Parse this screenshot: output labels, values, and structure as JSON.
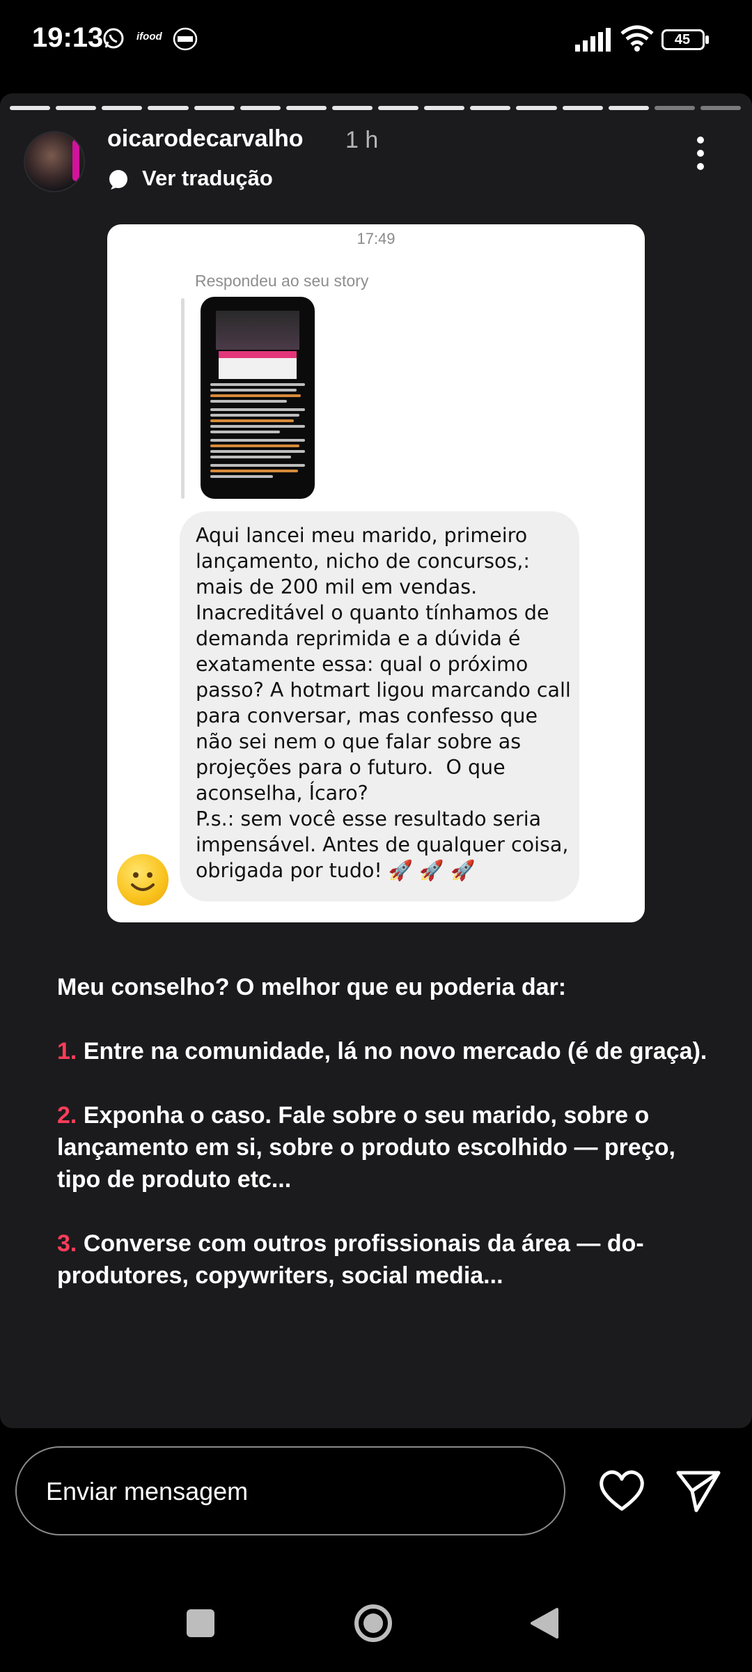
{
  "status_bar": {
    "time": "19:13",
    "app_icons": [
      "whatsapp-icon",
      "ifood-icon",
      "burger-king-icon"
    ],
    "ifood_label": "ifood",
    "battery": "45"
  },
  "story": {
    "progress_segments": 16,
    "username": "oicarodecarvalho",
    "time_ago": "1 h",
    "translate_label": "Ver tradução",
    "dm": {
      "time": "17:49",
      "reply_label": "Respondeu ao seu story",
      "message": "Aqui lancei meu marido, primeiro lançamento, nicho de concursos,: mais de 200 mil em vendas. Inacreditável o quanto tínhamos de demanda reprimida e a dúvida é exatamente essa: qual o próximo passo? A hotmart ligou marcando call para conversar, mas confesso que não sei nem o que falar sobre as projeções para o futuro.  O que aconselha, Ícaro?\nP.s.: sem você esse resultado seria impensável. Antes de qualquer coisa, obrigada por tudo! 🚀 🚀 🚀"
    },
    "advice": {
      "intro": "Meu conselho? O melhor que eu poderia dar:",
      "items": [
        {
          "num": "1.",
          "text": "Entre na comunidade, lá no novo mercado (é de graça)."
        },
        {
          "num": "2.",
          "text": "Exponha o caso. Fale sobre o seu marido, sobre o lançamento em si, sobre o produto escolhido — preço, tipo de produto etc..."
        },
        {
          "num": "3.",
          "text": "Converse com outros profissionais da área — do-produtores, copywriters, social media..."
        }
      ]
    }
  },
  "reply_bar": {
    "placeholder": "Enviar mensagem"
  },
  "colors": {
    "accent_number": "#ff3d5a",
    "panel": "#1b1b1d"
  }
}
